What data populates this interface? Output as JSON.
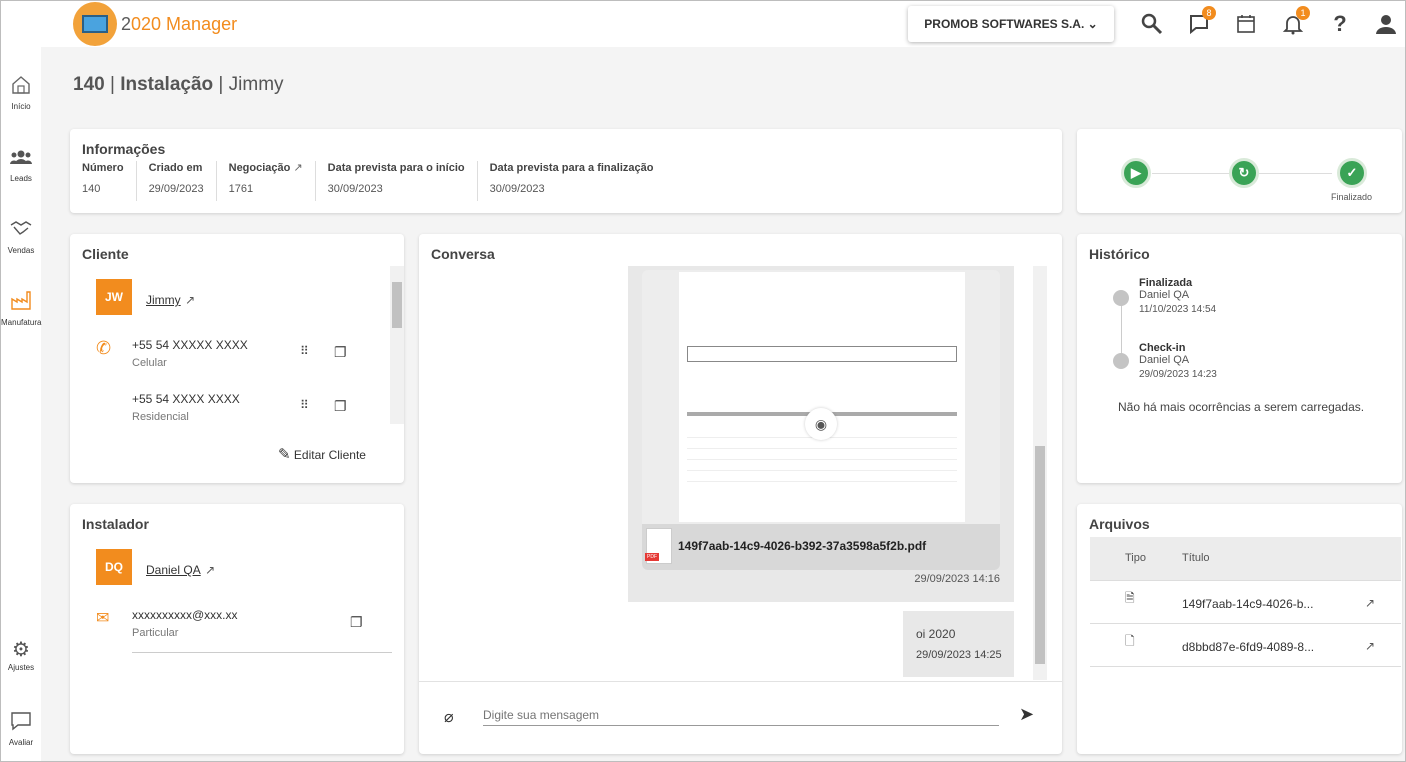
{
  "app": {
    "logo_prefix": "2",
    "logo_zero": "0",
    "logo_rest": "20 Manager"
  },
  "header": {
    "company": "PROMOB SOFTWARES S.A. ⌄",
    "chat_badge": "8",
    "notif_badge": "1",
    "help": "?"
  },
  "sidebar": {
    "items": [
      {
        "label": "Início"
      },
      {
        "label": "Leads"
      },
      {
        "label": "Vendas"
      },
      {
        "label": "Manufatura"
      },
      {
        "label": "Ajustes"
      },
      {
        "label": "Avaliar"
      }
    ]
  },
  "page": {
    "number": "140",
    "type": "Instalação",
    "client": "Jimmy"
  },
  "info": {
    "title": "Informações",
    "fields": [
      {
        "label": "Número",
        "value": "140"
      },
      {
        "label": "Criado em",
        "value": "29/09/2023"
      },
      {
        "label": "Negociação",
        "value": "1761"
      },
      {
        "label": "Data prevista para o início",
        "value": "30/09/2023"
      },
      {
        "label": "Data prevista para a finalização",
        "value": "30/09/2023"
      }
    ]
  },
  "status": {
    "final_label": "Finalizado"
  },
  "cliente": {
    "title": "Cliente",
    "initials": "JW",
    "name": "Jimmy",
    "phones": [
      {
        "number": "+55 54 XXXXX XXXX",
        "type": "Celular"
      },
      {
        "number": "+55 54 XXXX XXXX",
        "type": "Residencial"
      }
    ],
    "edit_label": "Editar Cliente"
  },
  "instalador": {
    "title": "Instalador",
    "initials": "DQ",
    "name": "Daniel QA",
    "email": "xxxxxxxxxx@xxx.xx",
    "email_type": "Particular"
  },
  "conversa": {
    "title": "Conversa",
    "file_msg": {
      "filename": "149f7aab-14c9-4026-b392-37a3598a5f2b.pdf",
      "time": "29/09/2023 14:16",
      "pdf_tag": "PDF"
    },
    "text_msg": {
      "text": "oi 2020",
      "time": "29/09/2023 14:25"
    },
    "input_placeholder": "Digite sua mensagem"
  },
  "historico": {
    "title": "Histórico",
    "events": [
      {
        "title": "Finalizada",
        "user": "Daniel QA",
        "date": "11/10/2023 14:54"
      },
      {
        "title": "Check-in",
        "user": "Daniel QA",
        "date": "29/09/2023 14:23"
      }
    ],
    "end_text": "Não há mais ocorrências a serem carregadas."
  },
  "arquivos": {
    "title": "Arquivos",
    "columns": [
      "Tipo",
      "Título"
    ],
    "rows": [
      {
        "icon": "pdf-file-icon",
        "title": "149f7aab-14c9-4026-b..."
      },
      {
        "icon": "file-icon",
        "title": "d8bbd87e-6fd9-4089-8..."
      }
    ]
  },
  "colors": {
    "accent": "#f28c1e",
    "success": "#3aa356"
  }
}
